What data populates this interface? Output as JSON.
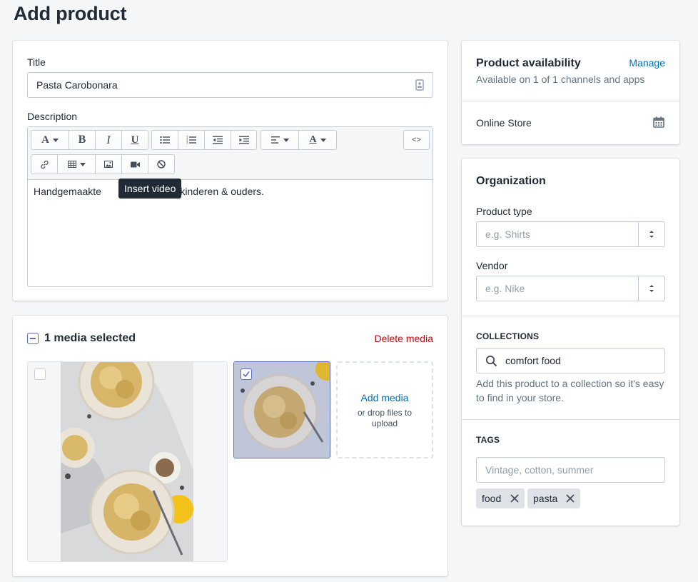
{
  "page": {
    "title": "Add product"
  },
  "product": {
    "title_label": "Title",
    "title_value": "Pasta Carobonara",
    "description_label": "Description",
    "description_value": "Handgemaakte",
    "description_value_end": "van kinderen & ouders.",
    "tooltip": "Insert video",
    "toolbar": {
      "code_label": "<>"
    }
  },
  "media": {
    "selected_label": "1 media selected",
    "delete_label": "Delete media",
    "add_media_label": "Add media",
    "drop_hint": "or drop files to upload"
  },
  "availability": {
    "title": "Product availability",
    "manage_label": "Manage",
    "subtitle": "Available on 1 of 1 channels and apps",
    "channel": "Online Store"
  },
  "organization": {
    "title": "Organization",
    "product_type_label": "Product type",
    "product_type_placeholder": "e.g. Shirts",
    "vendor_label": "Vendor",
    "vendor_placeholder": "e.g. Nike",
    "collections_heading": "COLLECTIONS",
    "collections_value": "comfort food",
    "collections_help": "Add this product to a collection so it's easy to find in your store.",
    "tags_heading": "TAGS",
    "tags_placeholder": "Vintage, cotton, summer",
    "tags": [
      "food",
      "pasta"
    ]
  },
  "colors": {
    "link": "#006fbb",
    "danger": "#bf0711",
    "background": "#f4f6f8",
    "selected_border": "#5c6ac4"
  },
  "icons": [
    "text-format-icon",
    "bold-icon",
    "italic-icon",
    "underline-icon",
    "bullet-list-icon",
    "numbered-list-icon",
    "outdent-icon",
    "indent-icon",
    "align-icon",
    "text-color-icon",
    "code-icon",
    "link-icon",
    "table-icon",
    "image-icon",
    "video-icon",
    "clear-format-icon",
    "calendar-icon",
    "search-icon",
    "select-arrows-icon",
    "close-icon",
    "checkbox-checked-icon",
    "checkbox-indeterminate-icon",
    "contact-card-icon"
  ]
}
